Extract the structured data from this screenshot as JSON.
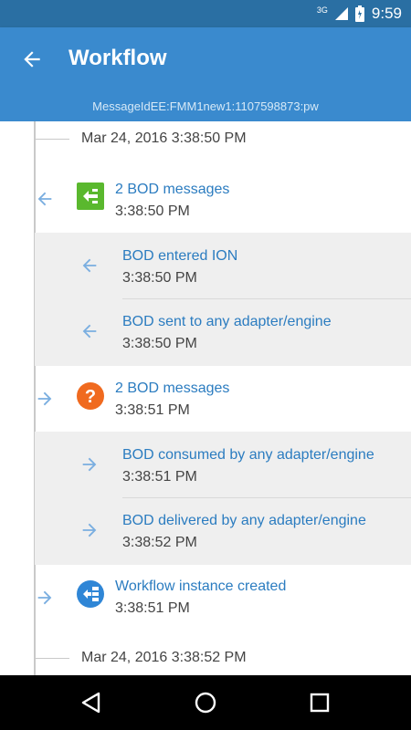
{
  "status_bar": {
    "network": "3G",
    "time": "9:59"
  },
  "app_bar": {
    "title": "Workflow"
  },
  "message_id": "MessageIdEE:FMM1new1:1107598873:pw",
  "timeline": {
    "date_top": "Mar 24, 2016 3:38:50 PM",
    "date_bottom": "Mar 24, 2016 3:38:52 PM",
    "groups": [
      {
        "title": "2 BOD messages",
        "time": "3:38:50 PM",
        "direction": "incoming",
        "icon": "bod-message-green-icon",
        "items": [
          {
            "title": "BOD entered ION",
            "time": "3:38:50 PM",
            "direction": "incoming"
          },
          {
            "title": "BOD sent to any adapter/engine",
            "time": "3:38:50 PM",
            "direction": "incoming"
          }
        ]
      },
      {
        "title": "2 BOD messages",
        "time": "3:38:51 PM",
        "direction": "outgoing",
        "icon": "question-orange-icon",
        "items": [
          {
            "title": "BOD consumed by any adapter/engine",
            "time": "3:38:51 PM",
            "direction": "outgoing"
          },
          {
            "title": "BOD delivered by any adapter/engine",
            "time": "3:38:52 PM",
            "direction": "outgoing"
          }
        ]
      },
      {
        "title": "Workflow instance created",
        "time": "3:38:51 PM",
        "direction": "outgoing",
        "icon": "workflow-blue-icon",
        "items": []
      }
    ]
  },
  "colors": {
    "appbar": "#3a8ace",
    "statusbar": "#2a6fa3",
    "link": "#2b7cc0",
    "arrow": "#7aaee0",
    "gray_bg": "#efefef"
  }
}
